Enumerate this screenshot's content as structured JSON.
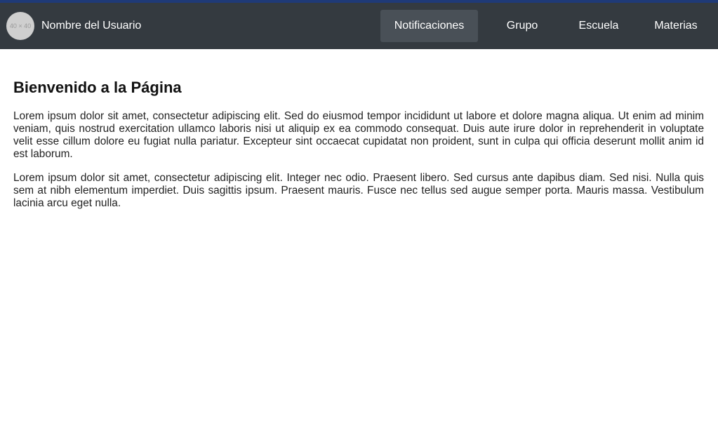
{
  "header": {
    "avatar_placeholder": "40 × 40",
    "username": "Nombre del Usuario",
    "nav": [
      {
        "label": "Notificaciones",
        "active": true
      },
      {
        "label": "Grupo",
        "active": false
      },
      {
        "label": "Escuela",
        "active": false
      },
      {
        "label": "Materias",
        "active": false
      }
    ]
  },
  "main": {
    "title": "Bienvenido a la Página",
    "paragraphs": [
      "Lorem ipsum dolor sit amet, consectetur adipiscing elit. Sed do eiusmod tempor incididunt ut labore et dolore magna aliqua. Ut enim ad minim veniam, quis nostrud exercitation ullamco laboris nisi ut aliquip ex ea commodo consequat. Duis aute irure dolor in reprehenderit in voluptate velit esse cillum dolore eu fugiat nulla pariatur. Excepteur sint occaecat cupidatat non proident, sunt in culpa qui officia deserunt mollit anim id est laborum.",
      "Lorem ipsum dolor sit amet, consectetur adipiscing elit. Integer nec odio. Praesent libero. Sed cursus ante dapibus diam. Sed nisi. Nulla quis sem at nibh elementum imperdiet. Duis sagittis ipsum. Praesent mauris. Fusce nec tellus sed augue semper porta. Mauris massa. Vestibulum lacinia arcu eget nulla."
    ]
  },
  "colors": {
    "accent_bar": "#1f3a78",
    "navbar_bg": "#343a40",
    "active_nav_bg": "#495057",
    "avatar_bg": "#cfcfcf"
  }
}
